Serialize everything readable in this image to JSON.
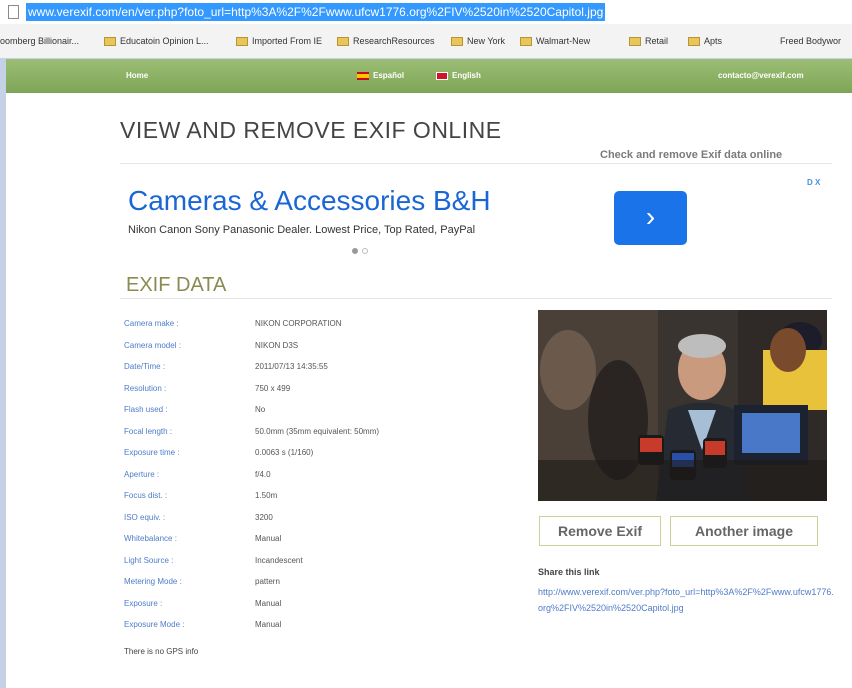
{
  "browser": {
    "url": "www.verexif.com/en/ver.php?foto_url=http%3A%2F%2Fwww.ufcw1776.org%2FIV%2520in%2520Capitol.jpg",
    "bookmarks": [
      "oomberg Billionair...",
      "Educatoin Opinion L...",
      "Imported From IE",
      "ResearchResources",
      "New York",
      "Walmart-New",
      "Retail",
      "Apts",
      "Freed Bodywor"
    ]
  },
  "nav": {
    "home": "Home",
    "espanol": "Español",
    "english": "English",
    "contact": "contacto@verexif.com"
  },
  "header": {
    "title": "VIEW AND REMOVE EXIF ONLINE",
    "tagline": "Check and remove Exif data online"
  },
  "ad": {
    "headline": "Cameras & Accessories B&H",
    "description": "Nikon Canon Sony Panasonic Dealer. Lowest Price, Top Rated, PayPal",
    "button_glyph": "›",
    "badge": "D X"
  },
  "exif": {
    "section_title": "EXIF DATA",
    "rows": [
      {
        "label": "Camera make :",
        "value": "NIKON CORPORATION"
      },
      {
        "label": "Camera model :",
        "value": "NIKON D3S"
      },
      {
        "label": "Date/Time :",
        "value": "2011/07/13 14:35:55"
      },
      {
        "label": "Resolution :",
        "value": "750 x 499"
      },
      {
        "label": "Flash used :",
        "value": "No"
      },
      {
        "label": "Focal length :",
        "value": "50.0mm (35mm equivalent: 50mm)"
      },
      {
        "label": "Exposure time :",
        "value": "0.0063 s (1/160)"
      },
      {
        "label": "Aperture :",
        "value": "f/4.0"
      },
      {
        "label": "Focus dist. :",
        "value": "1.50m"
      },
      {
        "label": "ISO equiv. :",
        "value": "3200"
      },
      {
        "label": "Whitebalance :",
        "value": "Manual"
      },
      {
        "label": "Light Source :",
        "value": "Incandescent"
      },
      {
        "label": "Metering Mode :",
        "value": "pattern"
      },
      {
        "label": "Exposure :",
        "value": "Manual"
      },
      {
        "label": "Exposure Mode :",
        "value": "Manual"
      }
    ],
    "gps_note": "There is no GPS info"
  },
  "actions": {
    "remove": "Remove Exif",
    "another": "Another image"
  },
  "share": {
    "title": "Share this link",
    "link": "http://www.verexif.com/ver.php?foto_url=http%3A%2F%2Fwww.ufcw1776.org%2FIV%2520in%2520Capitol.jpg"
  }
}
